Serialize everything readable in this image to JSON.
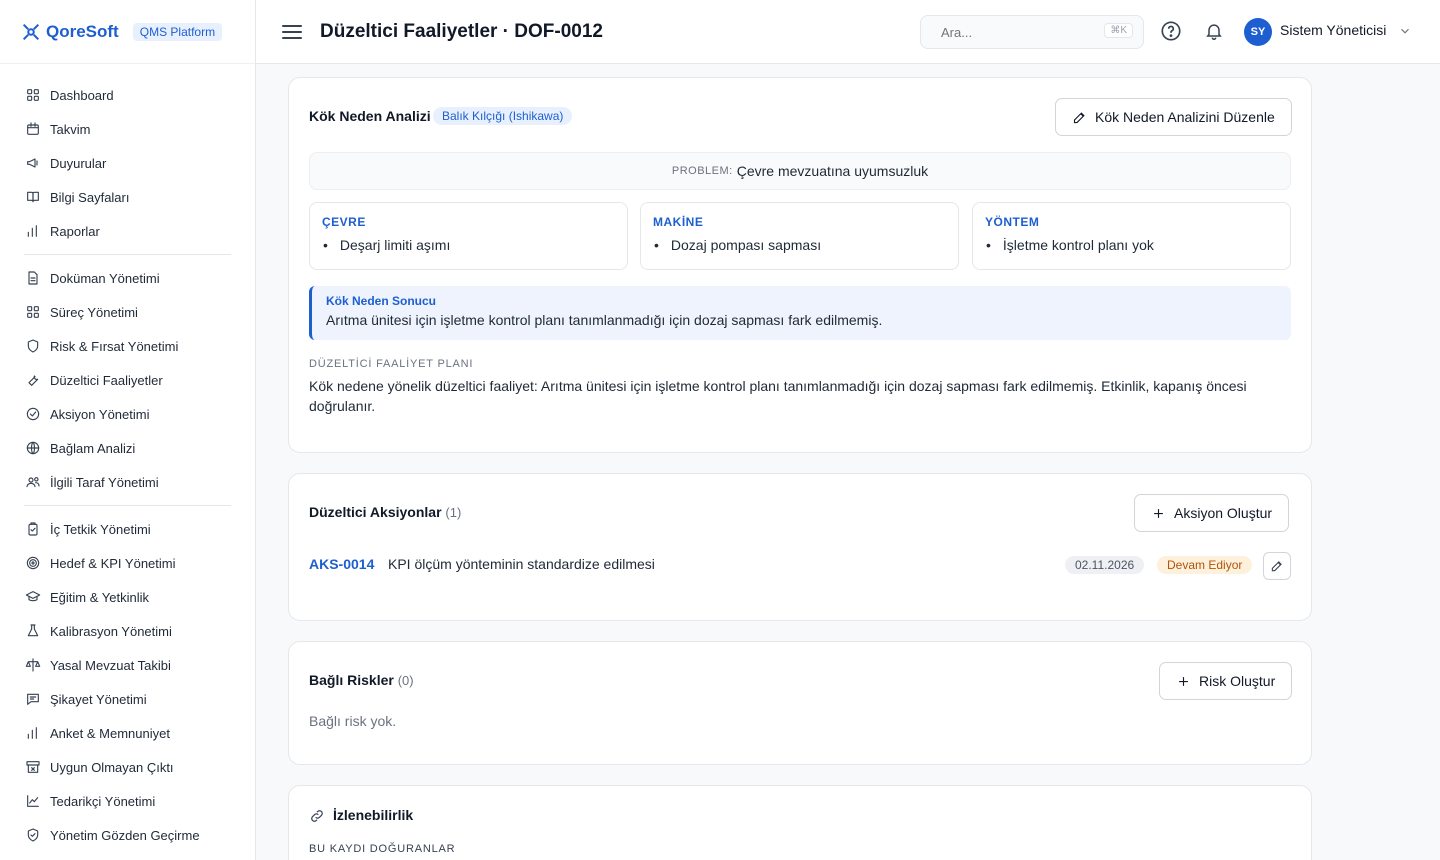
{
  "brand": {
    "name": "QoreSoft",
    "badge": "QMS Platform"
  },
  "sidebar": {
    "groups": [
      [
        {
          "label": "Dashboard",
          "icon": "grid-icon"
        },
        {
          "label": "Takvim",
          "icon": "calendar-icon"
        },
        {
          "label": "Duyurular",
          "icon": "megaphone-icon"
        },
        {
          "label": "Bilgi Sayfaları",
          "icon": "book-icon"
        },
        {
          "label": "Raporlar",
          "icon": "bar-chart-icon"
        }
      ],
      [
        {
          "label": "Doküman Yönetimi",
          "icon": "document-icon"
        },
        {
          "label": "Süreç Yönetimi",
          "icon": "grid-icon"
        },
        {
          "label": "Risk & Fırsat Yönetimi",
          "icon": "shield-icon"
        },
        {
          "label": "Düzeltici Faaliyetler",
          "icon": "wrench-icon"
        },
        {
          "label": "Aksiyon Yönetimi",
          "icon": "check-circle-icon"
        },
        {
          "label": "Bağlam Analizi",
          "icon": "globe-icon"
        },
        {
          "label": "İlgili Taraf Yönetimi",
          "icon": "users-icon"
        }
      ],
      [
        {
          "label": "İç Tetkik Yönetimi",
          "icon": "clipboard-icon"
        },
        {
          "label": "Hedef & KPI Yönetimi",
          "icon": "target-icon"
        },
        {
          "label": "Eğitim & Yetkinlik",
          "icon": "graduation-cap-icon"
        },
        {
          "label": "Kalibrasyon Yönetimi",
          "icon": "flask-icon"
        },
        {
          "label": "Yasal Mevzuat Takibi",
          "icon": "scale-icon"
        },
        {
          "label": "Şikayet Yönetimi",
          "icon": "message-icon"
        },
        {
          "label": "Anket & Memnuniyet",
          "icon": "bar-chart-icon"
        },
        {
          "label": "Uygun Olmayan Çıktı",
          "icon": "archive-x-icon"
        },
        {
          "label": "Tedarikçi Yönetimi",
          "icon": "line-chart-icon"
        },
        {
          "label": "Yönetim Gözden Geçirme",
          "icon": "shield-check-icon"
        }
      ]
    ]
  },
  "header": {
    "title": "Düzeltici Faaliyetler · DOF-0012",
    "search_placeholder": "Ara...",
    "search_shortcut": "⌘K",
    "user_initials": "SY",
    "user_name": "Sistem Yöneticisi"
  },
  "root_cause": {
    "title": "Kök Neden Analizi",
    "method": "Balık Kılçığı (Ishikawa)",
    "edit_label": "Kök Neden Analizini Düzenle",
    "problem_label": "PROBLEM:",
    "problem": "Çevre mevzuatına uyumsuzluk",
    "categories": [
      {
        "name": "ÇEVRE",
        "items": [
          "Deşarj limiti aşımı"
        ]
      },
      {
        "name": "MAKİNE",
        "items": [
          "Dozaj pompası sapması"
        ]
      },
      {
        "name": "YÖNTEM",
        "items": [
          "İşletme kontrol planı yok"
        ]
      }
    ],
    "result_title": "Kök Neden Sonucu",
    "result_text": "Arıtma ünitesi için işletme kontrol planı tanımlanmadığı için dozaj sapması fark edilmemiş.",
    "plan_label": "DÜZELTİCİ FAALİYET PLANI",
    "plan_text": "Kök nedene yönelik düzeltici faaliyet: Arıtma ünitesi için işletme kontrol planı tanımlanmadığı için dozaj sapması fark edilmemiş. Etkinlik, kapanış öncesi doğrulanır."
  },
  "actions": {
    "title": "Düzeltici Aksiyonlar",
    "count": "(1)",
    "create_label": "Aksiyon Oluştur",
    "items": [
      {
        "id": "AKS-0014",
        "title": "KPI ölçüm yönteminin standardize edilmesi",
        "date": "02.11.2026",
        "status": "Devam Ediyor"
      }
    ]
  },
  "risks": {
    "title": "Bağlı Riskler",
    "count": "(0)",
    "create_label": "Risk Oluştur",
    "empty": "Bağlı risk yok."
  },
  "traceability": {
    "title": "İzlenebilirlik",
    "subtitle": "BU KAYDI DOĞURANLAR"
  },
  "colors": {
    "accent": "#1d5fd1",
    "status_in_progress": "#b45309"
  }
}
